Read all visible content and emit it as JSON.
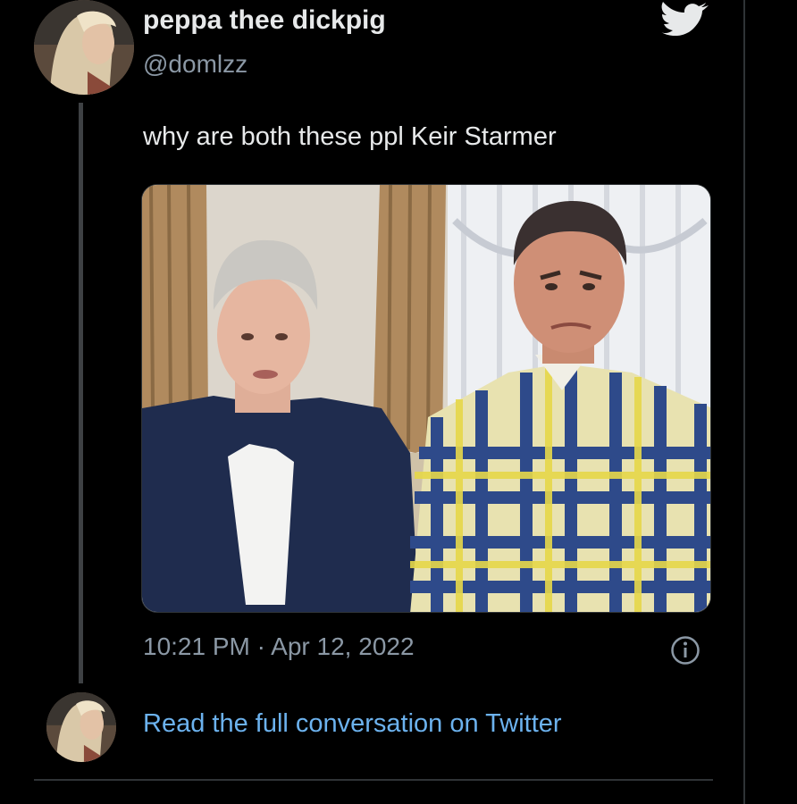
{
  "tweet": {
    "display_name": "peppa thee dickpig",
    "handle": "@domlzz",
    "text": "why are both these ppl Keir Starmer",
    "timestamp": "10:21 PM · Apr 12, 2022",
    "read_full_link": "Read the full conversation on Twitter"
  },
  "icons": {
    "brand": "twitter-bird-icon",
    "info": "info-icon"
  },
  "colors": {
    "background": "#000000",
    "primary_text": "#e7e9ea",
    "secondary_text": "#8b98a5",
    "link": "#6cb2ee",
    "twitter_bird": "#e7e9ea"
  }
}
